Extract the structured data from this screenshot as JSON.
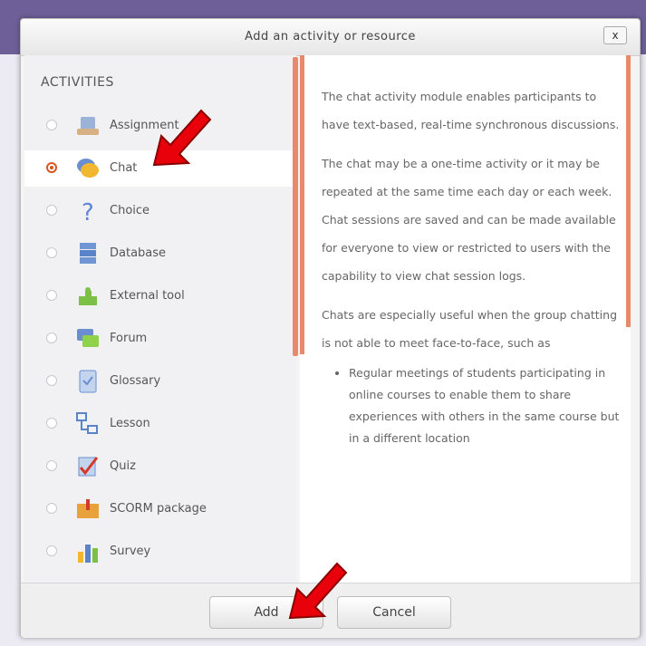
{
  "dialog": {
    "title": "Add an activity or resource",
    "close_label": "x"
  },
  "activities": {
    "heading": "ACTIVITIES",
    "items": [
      {
        "label": "Assignment",
        "icon": "assignment-icon",
        "selected": false
      },
      {
        "label": "Chat",
        "icon": "chat-icon",
        "selected": true
      },
      {
        "label": "Choice",
        "icon": "choice-icon",
        "selected": false
      },
      {
        "label": "Database",
        "icon": "database-icon",
        "selected": false
      },
      {
        "label": "External tool",
        "icon": "external-tool-icon",
        "selected": false
      },
      {
        "label": "Forum",
        "icon": "forum-icon",
        "selected": false
      },
      {
        "label": "Glossary",
        "icon": "glossary-icon",
        "selected": false
      },
      {
        "label": "Lesson",
        "icon": "lesson-icon",
        "selected": false
      },
      {
        "label": "Quiz",
        "icon": "quiz-icon",
        "selected": false
      },
      {
        "label": "SCORM package",
        "icon": "scorm-icon",
        "selected": false
      },
      {
        "label": "Survey",
        "icon": "survey-icon",
        "selected": false
      }
    ]
  },
  "description": {
    "paragraphs": [
      "The chat activity module enables participants to have text-based, real-time synchronous discussions.",
      "The chat may be a one-time activity or it may be repeated at the same time each day or each week. Chat sessions are saved and can be made available for everyone to view or restricted to users with the capability to view chat session logs.",
      "Chats are especially useful when the group chatting is not able to meet face-to-face, such as"
    ],
    "bullets": [
      "Regular meetings of students participating in online courses to enable them to share experiences with others in the same course but in a different location"
    ]
  },
  "footer": {
    "add_label": "Add",
    "cancel_label": "Cancel"
  },
  "colors": {
    "accent": "#e88a6a",
    "radio_selected": "#d9541e",
    "arrow": "#e8000b"
  }
}
